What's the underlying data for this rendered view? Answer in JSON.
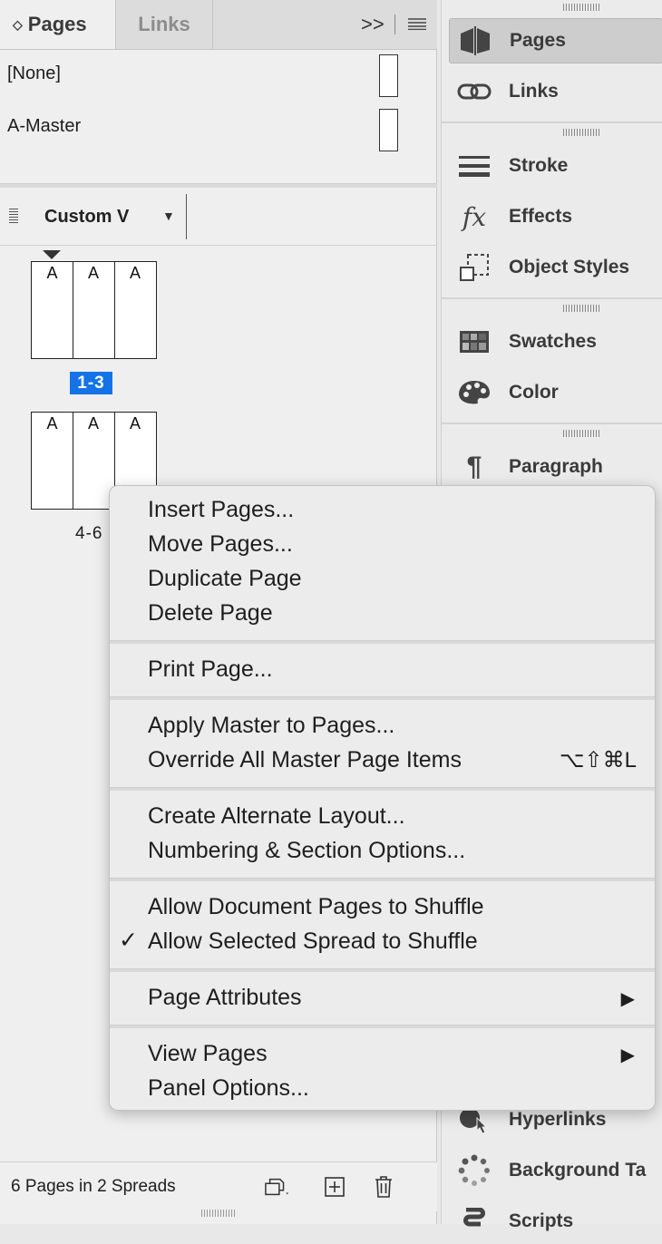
{
  "pages_panel": {
    "tabs": [
      {
        "label": "Pages"
      },
      {
        "label": "Links"
      }
    ],
    "expand_glyph": ">>",
    "masters": [
      {
        "label": "[None]"
      },
      {
        "label": "A-Master"
      }
    ],
    "view": {
      "label": "Custom V"
    },
    "spreads": [
      {
        "label": "1-3",
        "pages": [
          "A",
          "A",
          "A"
        ],
        "selected": true
      },
      {
        "label": "4-6",
        "pages": [
          "A",
          "A",
          "A"
        ],
        "selected": false
      }
    ],
    "footer": {
      "status": "6 Pages in 2 Spreads"
    }
  },
  "dock": {
    "items": [
      {
        "label": "Pages",
        "icon": "pages-icon",
        "active": true
      },
      {
        "label": "Links",
        "icon": "links-icon"
      },
      {
        "label": "Stroke",
        "icon": "stroke-icon"
      },
      {
        "label": "Effects",
        "icon": "effects-icon",
        "glyph": "fx"
      },
      {
        "label": "Object Styles",
        "icon": "object-styles-icon"
      },
      {
        "label": "Swatches",
        "icon": "swatches-icon"
      },
      {
        "label": "Color",
        "icon": "color-icon"
      },
      {
        "label": "Paragraph",
        "icon": "paragraph-icon",
        "glyph": "¶"
      },
      {
        "label": "Hyperlinks",
        "icon": "hyperlinks-icon"
      },
      {
        "label": "Background Ta",
        "icon": "background-tasks-icon"
      },
      {
        "label": "Scripts",
        "icon": "scripts-icon"
      }
    ]
  },
  "context_menu": {
    "items": [
      {
        "label": "Insert Pages..."
      },
      {
        "label": "Move Pages..."
      },
      {
        "label": "Duplicate Page"
      },
      {
        "label": "Delete Page"
      },
      {
        "label": "Print Page..."
      },
      {
        "label": "Apply Master to Pages..."
      },
      {
        "label": "Override All Master Page Items",
        "shortcut": "⌥⇧⌘L"
      },
      {
        "label": "Create Alternate Layout..."
      },
      {
        "label": "Numbering & Section Options..."
      },
      {
        "label": "Allow Document Pages to Shuffle"
      },
      {
        "label": "Allow Selected Spread to Shuffle",
        "checked": true,
        "check_glyph": "✓"
      },
      {
        "label": "Page Attributes",
        "submenu": true,
        "arrow": "▶"
      },
      {
        "label": "View Pages",
        "submenu": true,
        "arrow": "▶"
      },
      {
        "label": "Panel Options..."
      }
    ]
  }
}
